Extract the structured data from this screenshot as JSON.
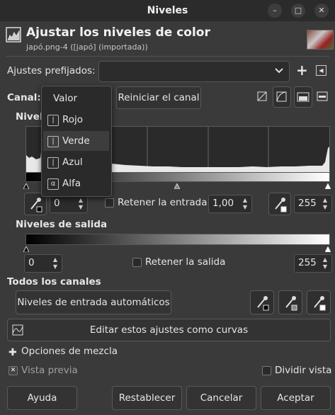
{
  "window": {
    "title": "Niveles",
    "minimize": "–",
    "maximize": "□",
    "close": "✕"
  },
  "header": {
    "title": "Ajustar los niveles de color",
    "subtitle": "japó.png-4 ([japó] (importada))"
  },
  "presets": {
    "label": "Ajustes prefijados:",
    "value": "",
    "add": "+",
    "menu": "◀"
  },
  "channel": {
    "label": "Canal:",
    "reset_button": "Reiniciar el canal",
    "menu": [
      {
        "label": "Valor",
        "icon": "",
        "selected": false
      },
      {
        "label": "Rojo",
        "icon": "|",
        "selected": false
      },
      {
        "label": "Verde",
        "icon": "|",
        "selected": true
      },
      {
        "label": "Azul",
        "icon": "|",
        "selected": false
      },
      {
        "label": "Alfa",
        "icon": "α",
        "selected": false
      }
    ]
  },
  "input_levels": {
    "label": "Nivele",
    "low": "0",
    "gamma": "1,00",
    "high": "255",
    "retain_label": "Retener la entrada"
  },
  "output_levels": {
    "label": "Niveles de salida",
    "low": "0",
    "high": "255",
    "retain_label": "Retener la salida"
  },
  "all_channels": {
    "label": "Todos los canales",
    "auto_button": "Niveles de entrada automáticos"
  },
  "edit_curves": "Editar estos ajustes como curvas",
  "blend_options": "Opciones de mezcla",
  "preview": {
    "label": "Vista previa",
    "checked": true
  },
  "split_view": {
    "label": "Dividir vista",
    "checked": false
  },
  "buttons": {
    "help": "Ayuda",
    "reset": "Restablecer",
    "cancel": "Cancelar",
    "ok": "Aceptar"
  }
}
